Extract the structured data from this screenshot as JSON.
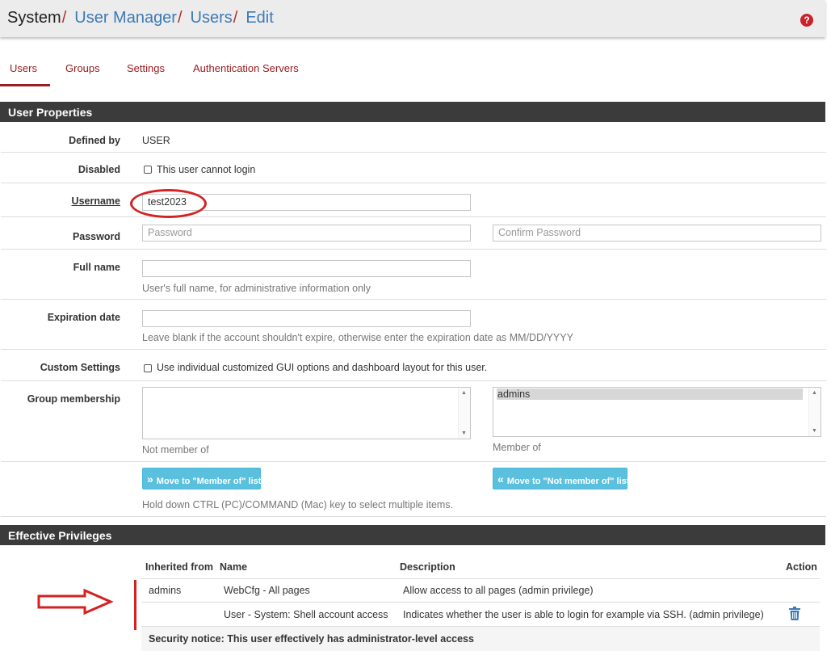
{
  "breadcrumb": {
    "root": "System",
    "items": [
      "User Manager",
      "Users",
      "Edit"
    ],
    "separator": "/"
  },
  "help_icon": {
    "icon": "question-circle-icon",
    "glyph": "?"
  },
  "tabs": [
    {
      "label": "Users",
      "active": true
    },
    {
      "label": "Groups",
      "active": false
    },
    {
      "label": "Settings",
      "active": false
    },
    {
      "label": "Authentication Servers",
      "active": false
    }
  ],
  "user_properties": {
    "heading": "User Properties",
    "defined_by": {
      "label": "Defined by",
      "value": "USER"
    },
    "disabled": {
      "label": "Disabled",
      "checkbox_label": "This user cannot login",
      "checked": false
    },
    "username": {
      "label": "Username",
      "value": "test2023"
    },
    "password": {
      "label": "Password",
      "placeholder": "Password",
      "confirm_placeholder": "Confirm Password"
    },
    "full_name": {
      "label": "Full name",
      "value": "",
      "help": "User's full name, for administrative information only"
    },
    "expiration": {
      "label": "Expiration date",
      "value": "",
      "help": "Leave blank if the account shouldn't expire, otherwise enter the expiration date as MM/DD/YYYY"
    },
    "custom_settings": {
      "label": "Custom Settings",
      "checkbox_label": "Use individual customized GUI options and dashboard layout for this user.",
      "checked": false
    },
    "group_membership": {
      "label": "Group membership",
      "not_member_of": {
        "caption": "Not member of",
        "options": []
      },
      "member_of": {
        "caption": "Member of",
        "options": [
          "admins"
        ]
      },
      "move_to_member_label": "Move to \"Member of\" list",
      "move_to_not_member_label": "Move to \"Not member of\" list",
      "hint": "Hold down CTRL (PC)/COMMAND (Mac) key to select multiple items."
    }
  },
  "effective_privileges": {
    "heading": "Effective Privileges",
    "columns": {
      "inherited": "Inherited from",
      "name": "Name",
      "description": "Description",
      "action": "Action"
    },
    "rows": [
      {
        "inherited": "admins",
        "name": "WebCfg - All pages",
        "description": "Allow access to all pages (admin privilege)"
      },
      {
        "inherited": "",
        "name": "User - System: Shell account access",
        "description": "Indicates whether the user is able to login for example via SSH. (admin privilege)",
        "action_icon": "trash-icon"
      }
    ],
    "security_notice": "Security notice: This user effectively has administrator-level access"
  },
  "colors": {
    "accent": "#9a1b20",
    "link": "#3c7ab7",
    "panel_header": "#3b3b3b",
    "button": "#5bc0de",
    "annotation": "#d42222"
  }
}
